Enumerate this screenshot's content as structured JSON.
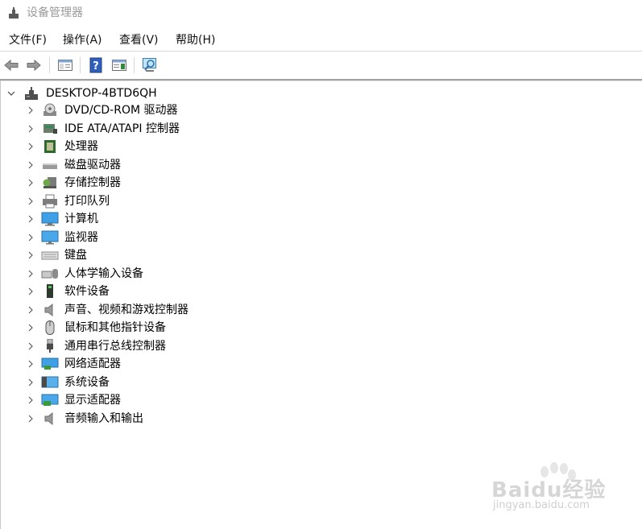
{
  "window": {
    "title": "设备管理器"
  },
  "menu": [
    {
      "label": "文件(F)"
    },
    {
      "label": "操作(A)"
    },
    {
      "label": "查看(V)"
    },
    {
      "label": "帮助(H)"
    }
  ],
  "toolbar": {
    "buttons": [
      "back-icon",
      "forward-icon",
      "show-hide-console-tree-icon",
      "help-icon",
      "action-pane-icon",
      "scan-hardware-icon"
    ]
  },
  "tree": {
    "root": {
      "label": "DESKTOP-4BTD6QH",
      "expanded": true
    },
    "items": [
      {
        "label": "DVD/CD-ROM 驱动器",
        "icon": "dvd-drive-icon"
      },
      {
        "label": "IDE ATA/ATAPI 控制器",
        "icon": "ide-controller-icon"
      },
      {
        "label": "处理器",
        "icon": "processor-icon"
      },
      {
        "label": "磁盘驱动器",
        "icon": "disk-drive-icon"
      },
      {
        "label": "存储控制器",
        "icon": "storage-controller-icon"
      },
      {
        "label": "打印队列",
        "icon": "printer-icon"
      },
      {
        "label": "计算机",
        "icon": "computer-icon"
      },
      {
        "label": "监视器",
        "icon": "monitor-icon"
      },
      {
        "label": "键盘",
        "icon": "keyboard-icon"
      },
      {
        "label": "人体学输入设备",
        "icon": "hid-icon"
      },
      {
        "label": "软件设备",
        "icon": "software-device-icon"
      },
      {
        "label": "声音、视频和游戏控制器",
        "icon": "sound-icon"
      },
      {
        "label": "鼠标和其他指针设备",
        "icon": "mouse-icon"
      },
      {
        "label": "通用串行总线控制器",
        "icon": "usb-icon"
      },
      {
        "label": "网络适配器",
        "icon": "network-adapter-icon"
      },
      {
        "label": "系统设备",
        "icon": "system-device-icon"
      },
      {
        "label": "显示适配器",
        "icon": "display-adapter-icon"
      },
      {
        "label": "音频输入和输出",
        "icon": "audio-io-icon"
      }
    ]
  },
  "watermark": {
    "text": "Baidu经验",
    "sub": "jingyan.baidu.com"
  }
}
